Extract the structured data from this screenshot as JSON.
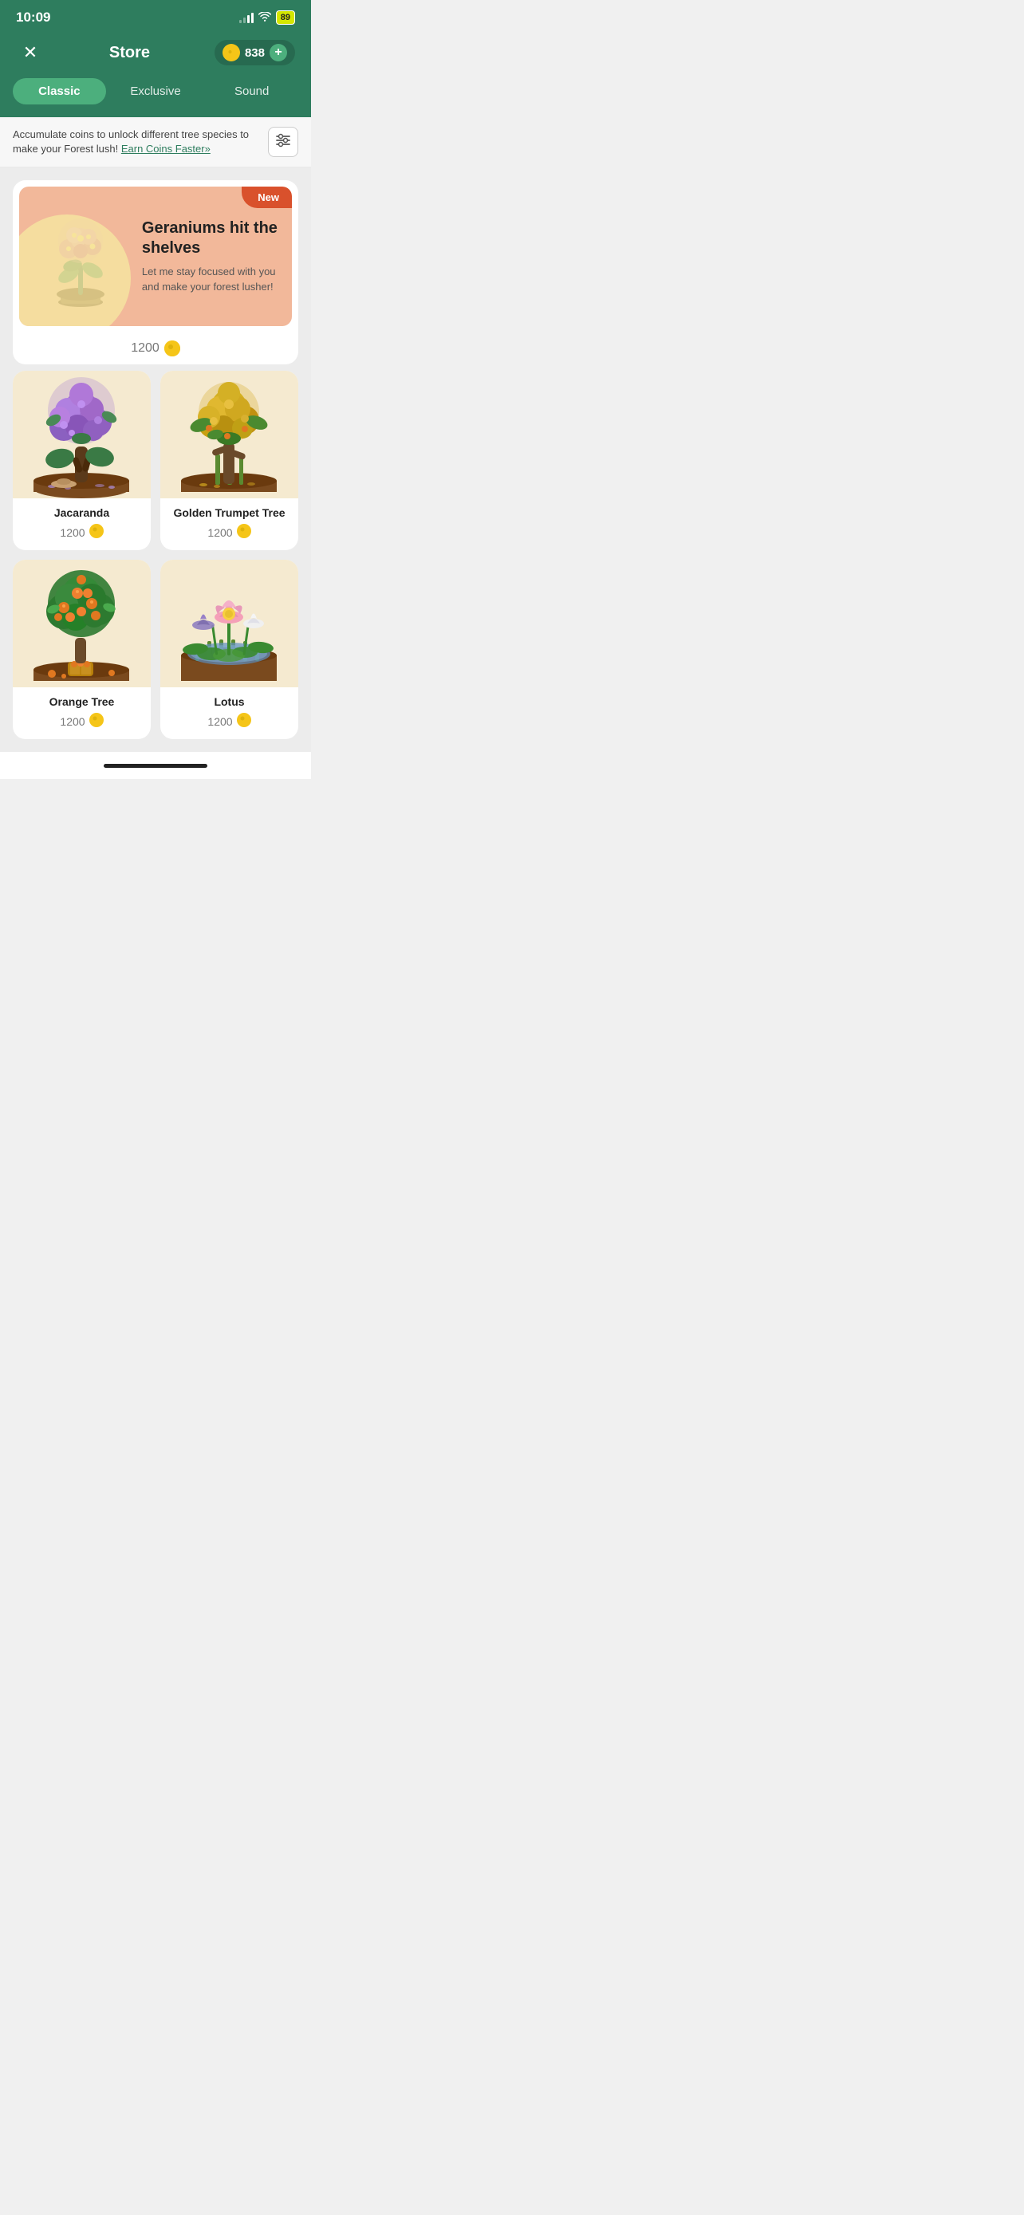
{
  "statusBar": {
    "time": "10:09",
    "battery": "89"
  },
  "header": {
    "title": "Store",
    "coinCount": "838"
  },
  "tabs": [
    {
      "id": "classic",
      "label": "Classic",
      "active": true
    },
    {
      "id": "exclusive",
      "label": "Exclusive",
      "active": false
    },
    {
      "id": "sound",
      "label": "Sound",
      "active": false
    }
  ],
  "infoBar": {
    "text": "Accumulate coins to unlock different tree species to make your Forest lush!",
    "earnLink": "Earn Coins Faster»"
  },
  "featuredBanner": {
    "newBadge": "New",
    "title": "Geraniums hit the shelves",
    "subtitle": "Let me stay focused with you and make your forest lusher!",
    "price": "1200"
  },
  "trees": [
    {
      "id": "jacaranda",
      "name": "Jacaranda",
      "price": "1200",
      "bgColor": "#f5ead0"
    },
    {
      "id": "golden-trumpet",
      "name": "Golden Trumpet Tree",
      "price": "1200",
      "bgColor": "#f5ead0"
    },
    {
      "id": "orange-tree",
      "name": "Orange Tree",
      "price": "1200",
      "bgColor": "#f5ead0"
    },
    {
      "id": "lotus",
      "name": "Lotus",
      "price": "1200",
      "bgColor": "#f5ead0"
    }
  ],
  "icons": {
    "close": "✕",
    "coinSymbol": "●",
    "plus": "+",
    "filter": "⊟"
  }
}
